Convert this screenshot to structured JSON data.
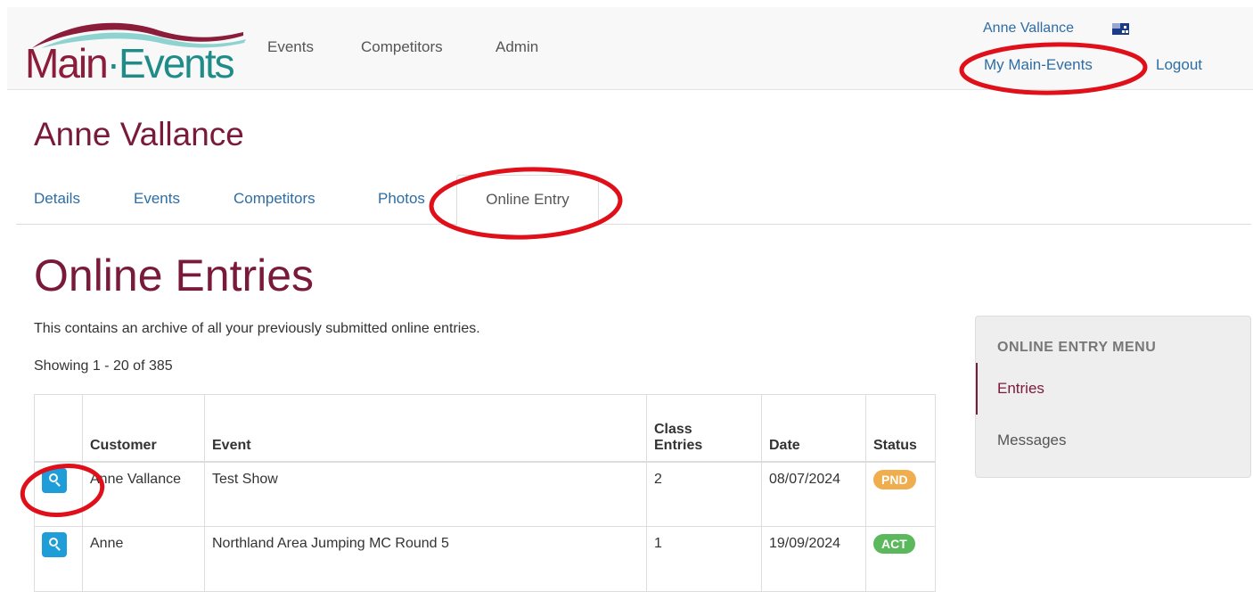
{
  "brand": {
    "logo_part1": "Main",
    "logo_part2": "Events"
  },
  "nav": {
    "items": [
      "Events",
      "Competitors",
      "Admin"
    ]
  },
  "user": {
    "name": "Anne Vallance",
    "my_link": "My Main-Events",
    "logout": "Logout"
  },
  "page_title": "Anne Vallance",
  "tabs": {
    "items": [
      "Details",
      "Events",
      "Competitors",
      "Photos"
    ],
    "active": "Online Entry"
  },
  "section": {
    "title": "Online Entries",
    "intro": "This contains an archive of all your previously submitted online entries.",
    "showing": "Showing 1 - 20 of 385"
  },
  "table": {
    "headers": {
      "customer": "Customer",
      "event": "Event",
      "class_line1": "Class",
      "class_line2": "Entries",
      "date": "Date",
      "status": "Status"
    },
    "rows": [
      {
        "customer": "Anne Vallance",
        "event": "Test Show",
        "class_entries": "2",
        "date": "08/07/2024",
        "status": "PND",
        "status_color": "#f0ad4e"
      },
      {
        "customer": "Anne",
        "event": "Northland Area Jumping MC Round 5",
        "class_entries": "1",
        "date": "19/09/2024",
        "status": "ACT",
        "status_color": "#5cb85c"
      }
    ]
  },
  "side_menu": {
    "header": "ONLINE ENTRY MENU",
    "items": [
      "Entries",
      "Messages"
    ],
    "active": "Entries"
  },
  "colors": {
    "brand": "#7a1a3a",
    "link": "#2e6da4",
    "annotation": "#e0101a"
  }
}
